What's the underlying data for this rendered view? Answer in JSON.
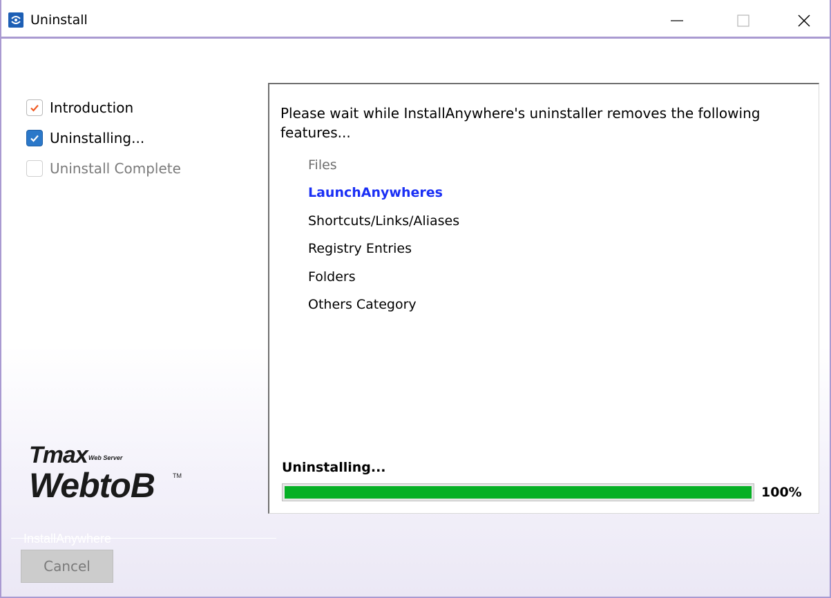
{
  "window": {
    "title": "Uninstall",
    "accent_color": "#a99ad1",
    "icons": {
      "app": "installer-icon",
      "minimize": "minimize-icon",
      "maximize": "maximize-icon",
      "close": "close-icon"
    }
  },
  "steps": [
    {
      "label": "Introduction",
      "state": "completed",
      "icon": "checkmark-icon",
      "check_color": "#f05a23"
    },
    {
      "label": "Uninstalling...",
      "state": "current",
      "icon": "checkmark-icon",
      "check_color": "#ffffff"
    },
    {
      "label": "Uninstall Complete",
      "state": "pending"
    }
  ],
  "logo": {
    "brand": "Tmax",
    "tagline": "Web Server",
    "product": "WebtoB",
    "trademark": "TM"
  },
  "content": {
    "intro_text": "Please wait while InstallAnywhere's uninstaller removes the following features...",
    "features": [
      {
        "label": "Files",
        "state": "done"
      },
      {
        "label": "LaunchAnywheres",
        "state": "current"
      },
      {
        "label": "Shortcuts/Links/Aliases",
        "state": "pending"
      },
      {
        "label": "Registry Entries",
        "state": "pending"
      },
      {
        "label": "Folders",
        "state": "pending"
      },
      {
        "label": "Others Category",
        "state": "pending"
      }
    ],
    "current_feature_color": "#1a2ff5"
  },
  "progress": {
    "label": "Uninstalling...",
    "percent_text": "100%",
    "value": 1.0,
    "color": "#06b025"
  },
  "footer": {
    "vendor_text": "InstallAnywhere",
    "cancel_label": "Cancel",
    "cancel_enabled": false
  }
}
